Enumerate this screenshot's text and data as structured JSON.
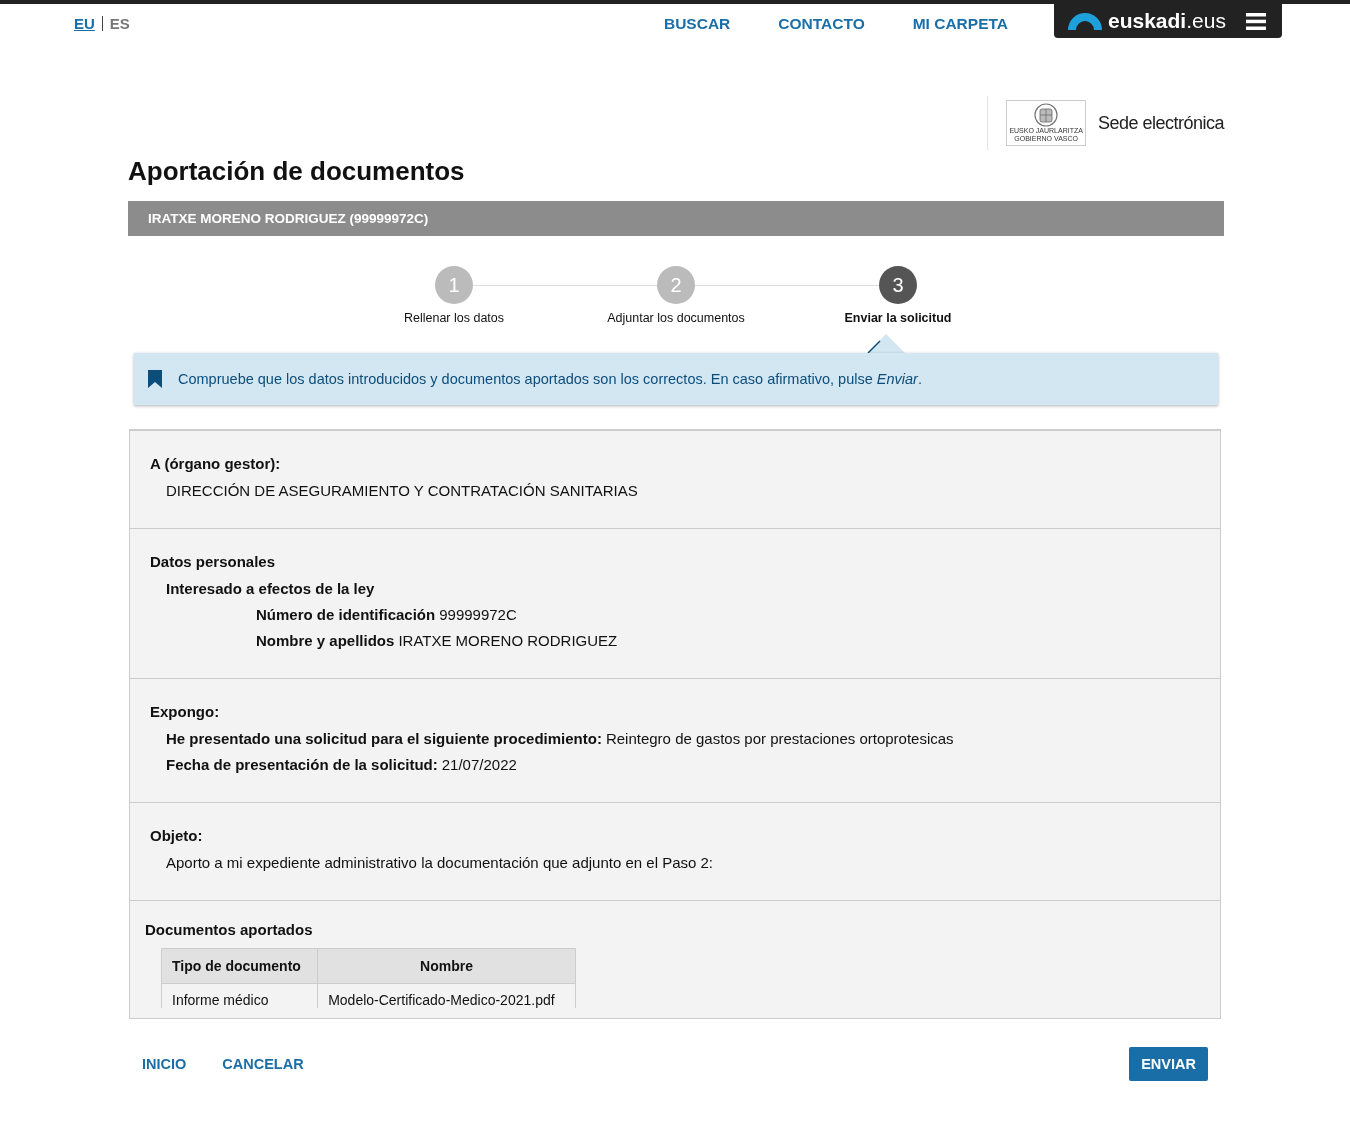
{
  "header": {
    "languages": [
      {
        "label": "EU",
        "selected": true
      },
      {
        "label": "ES",
        "selected": false
      }
    ],
    "nav": [
      "BUSCAR",
      "CONTACTO",
      "MI CARPETA"
    ],
    "brand": {
      "name": "euskadi",
      "suffix": ".eus"
    }
  },
  "sede": {
    "emblem_text": [
      "EUSKO JAURLARITZA",
      "GOBIERNO VASCO"
    ],
    "label": "Sede electrónica"
  },
  "title": "Aportación de documentos",
  "user_bar": "IRATXE MORENO RODRIGUEZ (99999972C)",
  "steps": [
    {
      "number": "1",
      "label": "Rellenar los datos",
      "selected": false
    },
    {
      "number": "2",
      "label": "Adjuntar los documentos",
      "selected": false
    },
    {
      "number": "3",
      "label": "Enviar la solicitud",
      "selected": true
    }
  ],
  "notice": "Compruebe que los datos introducidos y documentos aportados son los correctos. En caso afirmativo, pulse *Enviar*.",
  "sections": [
    {
      "title": "A (órgano gestor):",
      "items": [
        {
          "value": "DIRECCIÓN DE ASEGURAMIENTO Y CONTRATACIÓN SANITARIAS"
        }
      ]
    },
    {
      "title": "Datos personales",
      "items": [
        {
          "label": "Interesado a efectos de la ley",
          "children": [
            {
              "label": "Número de identificación",
              "value": "99999972C"
            },
            {
              "label": "Nombre y apellidos",
              "value": "IRATXE MORENO RODRIGUEZ"
            }
          ]
        }
      ]
    },
    {
      "title": "Expongo:",
      "items": [
        {
          "label": "He presentado una solicitud para el siguiente procedimiento:",
          "value": "Reintegro de gastos por prestaciones ortoprotesicas"
        },
        {
          "label": "Fecha de presentación de la solicitud:",
          "value": "21/07/2022"
        }
      ]
    },
    {
      "title": "Objeto:",
      "items": [
        {
          "value": "Aporto a mi expediente administrativo la documentación que adjunto en el Paso 2:"
        }
      ]
    }
  ],
  "documents": {
    "title": "Documentos aportados",
    "columns": [
      "Tipo de documento",
      "Nombre"
    ],
    "rows": [
      [
        "Informe médico",
        "Modelo-Certificado-Medico-2021.pdf"
      ]
    ]
  },
  "actions": {
    "links": [
      "INICIO",
      "CANCELAR"
    ],
    "submit": "ENVIAR"
  }
}
